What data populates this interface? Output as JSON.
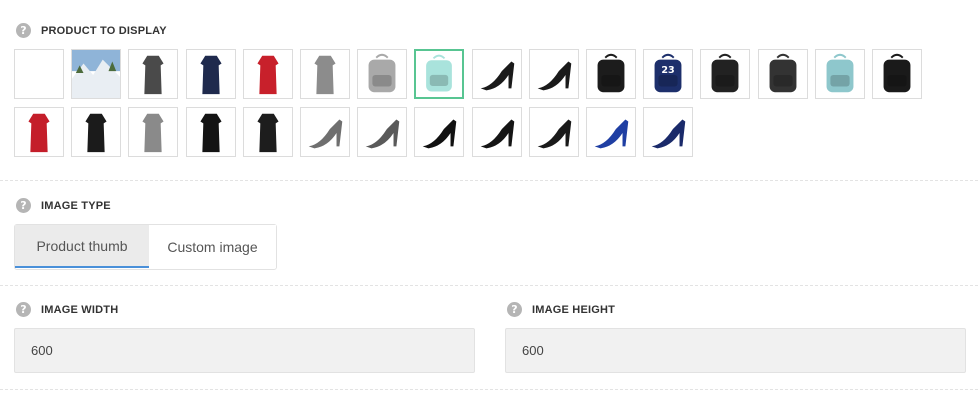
{
  "product_section": {
    "title": "PRODUCT TO DISPLAY",
    "help_icon": "question-icon",
    "selected_index": 7,
    "products": [
      {
        "name": "blank",
        "color": "#ffffff"
      },
      {
        "name": "snow-landscape",
        "color": "#8fb4d8"
      },
      {
        "name": "grey-dress",
        "color": "#4a4a4a"
      },
      {
        "name": "navy-dress",
        "color": "#1f2a4d"
      },
      {
        "name": "red-dress",
        "color": "#c8202b"
      },
      {
        "name": "grey-knit-dress",
        "color": "#8c8c8c"
      },
      {
        "name": "grey-backpack",
        "color": "#a9a9a9"
      },
      {
        "name": "mint-backpack",
        "color": "#a9e3dc"
      },
      {
        "name": "black-heel",
        "color": "#1a1a1a"
      },
      {
        "name": "black-bootie",
        "color": "#1a1a1a"
      },
      {
        "name": "black-backpack",
        "color": "#1c1c1c"
      },
      {
        "name": "navy-23-backpack",
        "color": "#1d2f6b"
      },
      {
        "name": "black-backpack-2",
        "color": "#222222"
      },
      {
        "name": "black-backpack-3",
        "color": "#333333"
      },
      {
        "name": "aqua-backpack",
        "color": "#8ec7cc"
      },
      {
        "name": "studded-backpack",
        "color": "#1a1a1a"
      },
      {
        "name": "red-long-dress",
        "color": "#c41e2a"
      },
      {
        "name": "black-dress",
        "color": "#1b1b1b"
      },
      {
        "name": "grey-belted-dress",
        "color": "#8a8a8a"
      },
      {
        "name": "black-sleeve-dress",
        "color": "#141414"
      },
      {
        "name": "black-dress-2",
        "color": "#1d1d1d"
      },
      {
        "name": "grey-pump",
        "color": "#6f6f6f"
      },
      {
        "name": "grey-glitter-pump",
        "color": "#5a5a5a"
      },
      {
        "name": "black-lace-heel",
        "color": "#111111"
      },
      {
        "name": "black-strap-heel",
        "color": "#151515"
      },
      {
        "name": "black-cage-heel",
        "color": "#1a1a1a"
      },
      {
        "name": "blue-pump",
        "color": "#1f3fa3"
      },
      {
        "name": "navy-fringe-heel",
        "color": "#1a2a6a"
      }
    ]
  },
  "image_type": {
    "title": "IMAGE TYPE",
    "help_icon": "question-icon",
    "tabs": [
      {
        "label": "Product thumb",
        "active": true
      },
      {
        "label": "Custom image",
        "active": false
      }
    ]
  },
  "image_width": {
    "title": "IMAGE WIDTH",
    "help_icon": "question-icon",
    "value": "600"
  },
  "image_height": {
    "title": "IMAGE HEIGHT",
    "help_icon": "question-icon",
    "value": "600"
  },
  "colors": {
    "selected_border": "#58c592",
    "active_tab_underline": "#4a90d9"
  }
}
